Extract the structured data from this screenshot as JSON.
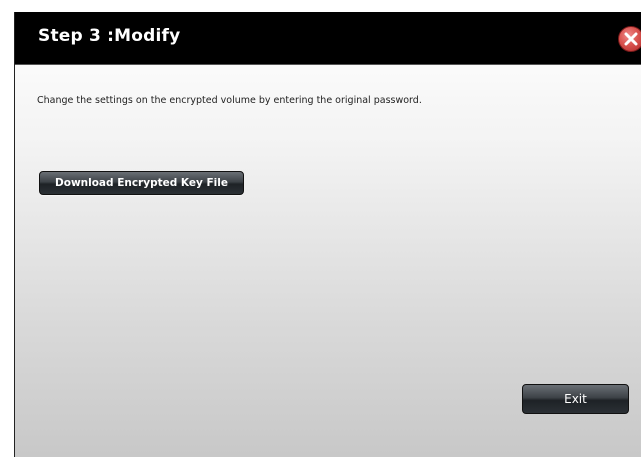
{
  "dialog": {
    "title": "Step 3 :Modify",
    "description": "Change the settings on the encrypted volume by entering the original password.",
    "download_button_label": "Download Encrypted Key File",
    "exit_button_label": "Exit"
  },
  "icons": {
    "close": "close-icon"
  },
  "colors": {
    "titlebar_background": "#000000",
    "title_text": "#ffffff",
    "close_button": "#d9534f",
    "button_dark": "#2b3035"
  }
}
